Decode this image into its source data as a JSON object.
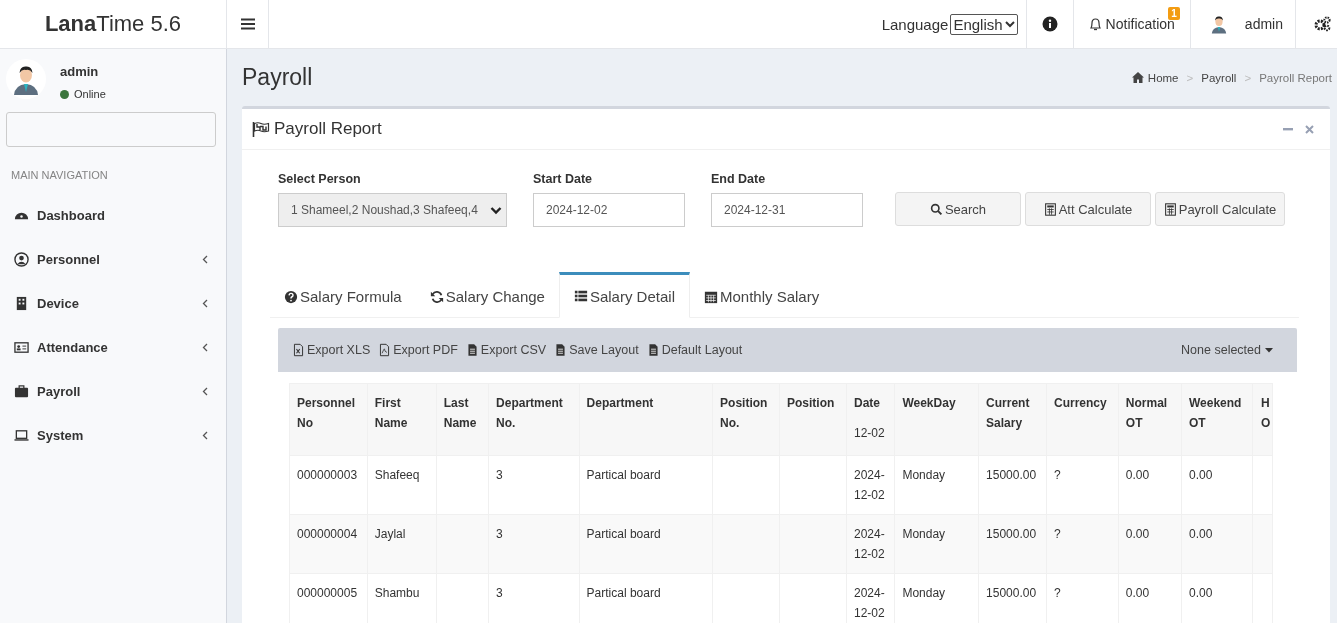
{
  "header": {
    "brand_bold": "Lana",
    "brand_rest": "Time 5.6",
    "language_label": "Language",
    "language_value": "English",
    "notification_label": "Notification",
    "notification_count": "1",
    "user": "admin"
  },
  "sidebar": {
    "user": {
      "name": "admin",
      "status": "Online"
    },
    "section_title": "MAIN NAVIGATION",
    "items": [
      {
        "label": "Dashboard",
        "expandable": false
      },
      {
        "label": "Personnel",
        "expandable": true
      },
      {
        "label": "Device",
        "expandable": true
      },
      {
        "label": "Attendance",
        "expandable": true
      },
      {
        "label": "Payroll",
        "expandable": true
      },
      {
        "label": "System",
        "expandable": true
      }
    ]
  },
  "page": {
    "title": "Payroll",
    "breadcrumb": [
      {
        "label": "Home"
      },
      {
        "separator": ">",
        "label": "Payroll"
      },
      {
        "separator": ">",
        "label": "Payroll Report"
      }
    ]
  },
  "report": {
    "title": "Payroll Report",
    "form": {
      "person_label": "Select Person",
      "person_value": "1 Shameel,2 Noushad,3 Shafeeq,4",
      "start_label": "Start Date",
      "start_value": "2024-12-02",
      "end_label": "End Date",
      "end_value": "2024-12-31"
    },
    "buttons": [
      "Search",
      "Att Calculate",
      "Payroll Calculate"
    ],
    "tabs": [
      {
        "label": "Salary Formula",
        "selected": false
      },
      {
        "label": "Salary Change",
        "selected": false
      },
      {
        "label": "Salary Detail",
        "selected": true
      },
      {
        "label": "Monthly Salary",
        "selected": false
      }
    ],
    "toolbar": {
      "actions": [
        "Export XLS",
        "Export PDF",
        "Export CSV",
        "Save Layout",
        "Default Layout"
      ],
      "column_filter": "None selected"
    },
    "table": {
      "columns": [
        {
          "label": "Personnel No"
        },
        {
          "label": "First Name"
        },
        {
          "label": "Last Name"
        },
        {
          "label": "Department No."
        },
        {
          "label": "Department"
        },
        {
          "label": "Position No."
        },
        {
          "label": "Position"
        },
        {
          "label": "Date",
          "sub": "12-02"
        },
        {
          "label": "WeekDay"
        },
        {
          "label": "Current Salary"
        },
        {
          "label": "Currency"
        },
        {
          "label": "Normal OT"
        },
        {
          "label": "Weekend OT"
        },
        {
          "label": "H O"
        }
      ],
      "rows": [
        [
          "000000003",
          "Shafeeq",
          null,
          "3",
          "Partical board",
          null,
          null,
          "2024-12-02",
          "Monday",
          "15000.00",
          "?",
          "0.00",
          "0.00",
          null
        ],
        [
          "000000004",
          "Jaylal",
          null,
          "3",
          "Partical board",
          null,
          null,
          "2024-12-02",
          "Monday",
          "15000.00",
          "?",
          "0.00",
          "0.00",
          null
        ],
        [
          "000000005",
          "Shambu",
          null,
          "3",
          "Partical board",
          null,
          null,
          "2024-12-02",
          "Monday",
          "15000.00",
          "?",
          "0.00",
          "0.00",
          null
        ]
      ]
    }
  }
}
